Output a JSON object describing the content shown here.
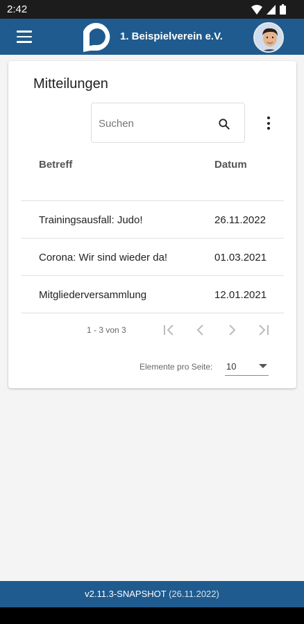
{
  "status_bar": {
    "time": "2:42"
  },
  "app_bar": {
    "title": "1. Beispielverein e.V."
  },
  "card": {
    "title": "Mitteilungen"
  },
  "search": {
    "placeholder": "Suchen",
    "value": ""
  },
  "table": {
    "columns": [
      "Betreff",
      "Datum"
    ],
    "rows": [
      {
        "subject": "Trainingsausfall: Judo!",
        "date": "26.11.2022"
      },
      {
        "subject": "Corona: Wir sind wieder da!",
        "date": "01.03.2021"
      },
      {
        "subject": "Mitgliederversammlung",
        "date": "12.01.2021"
      }
    ]
  },
  "pagination": {
    "range_label": "1 - 3 von 3",
    "items_per_page_label": "Elemente pro Seite:",
    "items_per_page_value": "10"
  },
  "footer": {
    "version": "v2.11.3-SNAPSHOT",
    "build_date": "(26.11.2022)"
  },
  "colors": {
    "primary": "#1f5b8e",
    "status_bar": "#1c1c1c",
    "background": "#f4f4f4"
  }
}
